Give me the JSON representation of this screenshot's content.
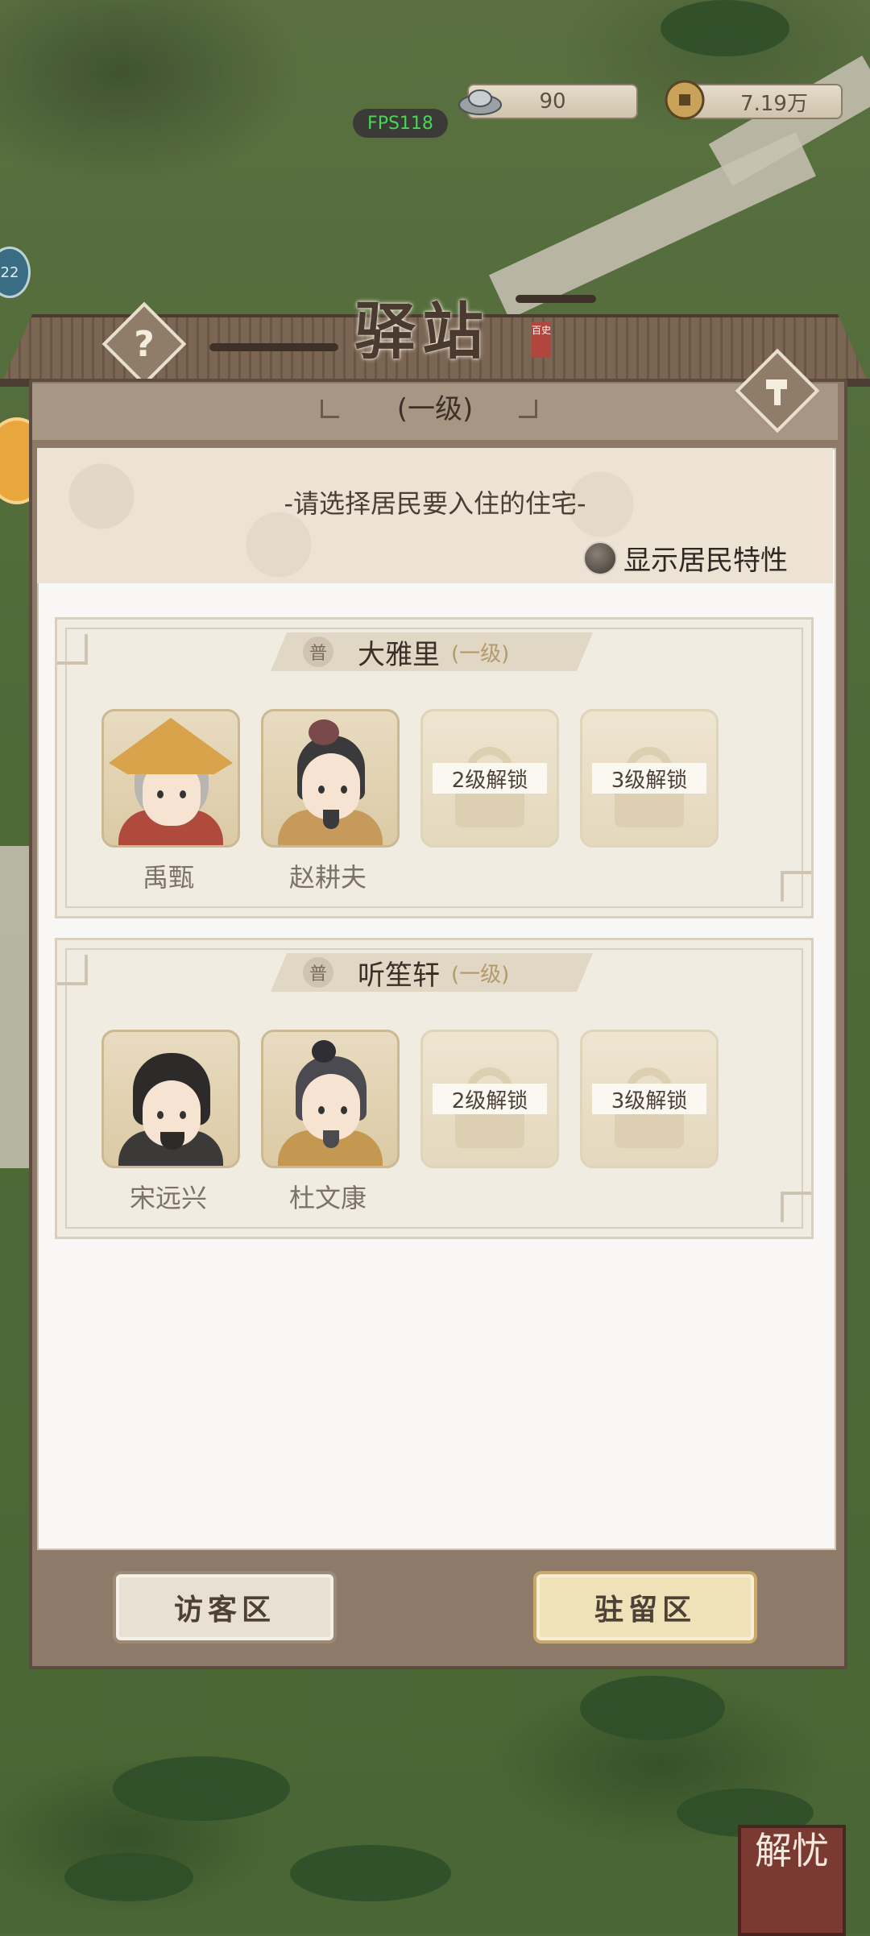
{
  "hud": {
    "silver_value": "90",
    "coin_value": "7.19万",
    "fps": "FPS118",
    "side_badge": "22"
  },
  "panel": {
    "title": "驿站",
    "title_seal": "百史",
    "level": "(一级)",
    "help_icon": "question-mark",
    "build_icon": "hammer",
    "prompt": "-请选择居民要入住的住宅-",
    "trait_toggle_label": "显示居民特性"
  },
  "houses": [
    {
      "badge": "普",
      "name": "大雅里",
      "level": "(一级)",
      "slots": [
        {
          "resident": "禹甄",
          "locked": false
        },
        {
          "resident": "赵耕夫",
          "locked": false
        },
        {
          "lock_label": "2级解锁",
          "locked": true
        },
        {
          "lock_label": "3级解锁",
          "locked": true
        }
      ]
    },
    {
      "badge": "普",
      "name": "听笙轩",
      "level": "(一级)",
      "slots": [
        {
          "resident": "宋远兴",
          "locked": false
        },
        {
          "resident": "杜文康",
          "locked": false
        },
        {
          "lock_label": "2级解锁",
          "locked": true
        },
        {
          "lock_label": "3级解锁",
          "locked": true
        }
      ]
    }
  ],
  "buttons": {
    "visitor": "访客区",
    "stay": "驻留区"
  },
  "corner_badge": "解忧",
  "colors": {
    "panel_wood": "#8d7a68",
    "panel_body": "#f8f7f5",
    "accent_gold": "#b39a6c",
    "fps_green": "#4bd45a"
  }
}
